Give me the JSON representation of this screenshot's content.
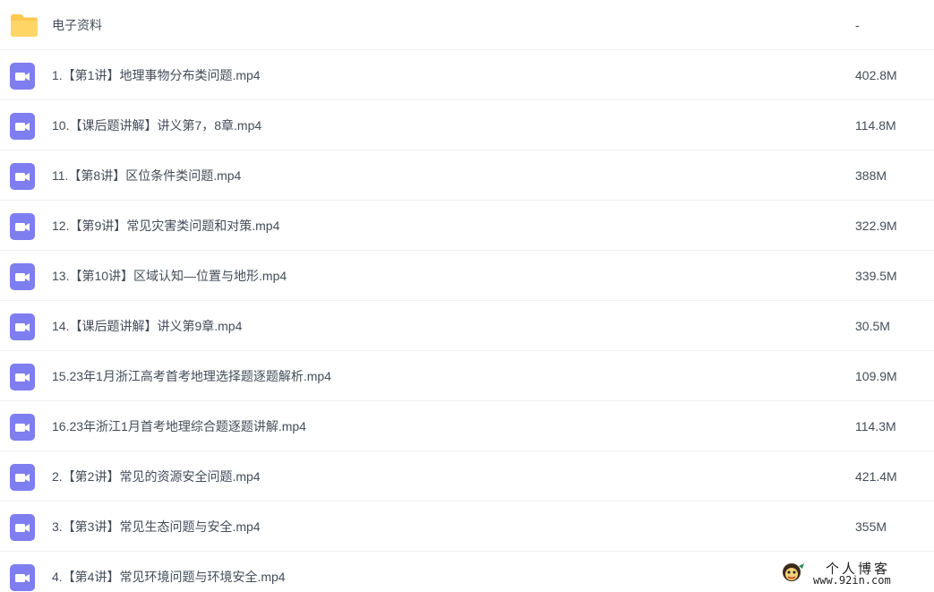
{
  "files": [
    {
      "type": "folder",
      "icon": "folder-icon",
      "name": "电子资料",
      "size": "-"
    },
    {
      "type": "video",
      "icon": "video-file-icon",
      "name": "1.【第1讲】地理事物分布类问题.mp4",
      "size": "402.8M"
    },
    {
      "type": "video",
      "icon": "video-file-icon",
      "name": "10.【课后题讲解】讲义第7，8章.mp4",
      "size": "114.8M"
    },
    {
      "type": "video",
      "icon": "video-file-icon",
      "name": "11.【第8讲】区位条件类问题.mp4",
      "size": "388M"
    },
    {
      "type": "video",
      "icon": "video-file-icon",
      "name": "12.【第9讲】常见灾害类问题和对策.mp4",
      "size": "322.9M"
    },
    {
      "type": "video",
      "icon": "video-file-icon",
      "name": "13.【第10讲】区域认知—位置与地形.mp4",
      "size": "339.5M"
    },
    {
      "type": "video",
      "icon": "video-file-icon",
      "name": "14.【课后题讲解】讲义第9章.mp4",
      "size": "30.5M"
    },
    {
      "type": "video",
      "icon": "video-file-icon",
      "name": "15.23年1月浙江高考首考地理选择题逐题解析.mp4",
      "size": "109.9M"
    },
    {
      "type": "video",
      "icon": "video-file-icon",
      "name": "16.23年浙江1月首考地理综合题逐题讲解.mp4",
      "size": "114.3M"
    },
    {
      "type": "video",
      "icon": "video-file-icon",
      "name": "2.【第2讲】常见的资源安全问题.mp4",
      "size": "421.4M"
    },
    {
      "type": "video",
      "icon": "video-file-icon",
      "name": "3.【第3讲】常见生态问题与安全.mp4",
      "size": "355M"
    },
    {
      "type": "video",
      "icon": "video-file-icon",
      "name": "4.【第4讲】常见环境问题与环境安全.mp4",
      "size": ""
    }
  ],
  "watermark": {
    "title": "个人博客",
    "url": "www.92in.com"
  },
  "colors": {
    "folder": "#ffc94d",
    "video": "#7f7ef0",
    "text": "#454d5a",
    "divider": "#f1f2f4"
  }
}
